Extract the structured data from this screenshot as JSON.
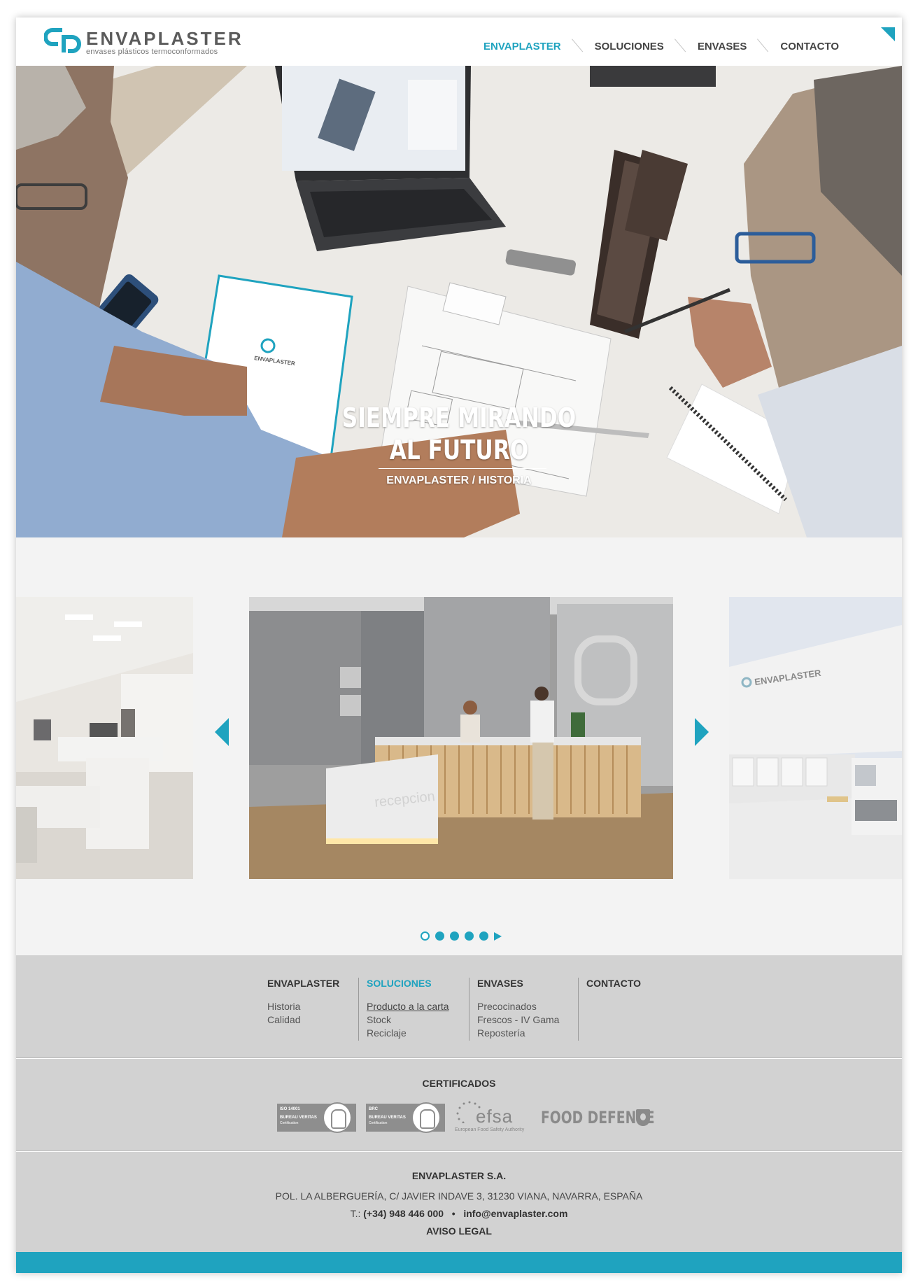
{
  "brand": {
    "name": "ENVAPLASTER",
    "tagline": "envases plásticos termoconformados",
    "accent_color": "#1fa3bf"
  },
  "nav": {
    "items": [
      {
        "label": "ENVAPLASTER",
        "active": true
      },
      {
        "label": "SOLUCIONES",
        "active": false
      },
      {
        "label": "ENVASES",
        "active": false
      },
      {
        "label": "CONTACTO",
        "active": false
      }
    ]
  },
  "hero": {
    "title_line1": "SIEMPRE MIRANDO",
    "title_line2": "AL FUTURO",
    "link": "ENVAPLASTER / HISTORIA",
    "folder_brand": "ENVAPLASTER"
  },
  "carousel": {
    "slides": [
      "office",
      "reception",
      "warehouse"
    ],
    "reception_sign": "recepcion",
    "building_sign": "ENVAPLASTER",
    "pager": {
      "count": 5,
      "current": 1
    }
  },
  "footer": {
    "columns": [
      {
        "title": "ENVAPLASTER",
        "active": false,
        "links": [
          "Historia",
          "Calidad"
        ]
      },
      {
        "title": "SOLUCIONES",
        "active": true,
        "links": [
          "Producto a la carta",
          "Stock",
          "Reciclaje"
        ]
      },
      {
        "title": "ENVASES",
        "active": false,
        "links": [
          "Precocinados",
          "Frescos - IV Gama",
          "Repostería"
        ]
      },
      {
        "title": "CONTACTO",
        "active": false,
        "links": []
      }
    ],
    "certificates": {
      "title": "CERTIFICADOS",
      "bv1": {
        "line1": "ISO 14001",
        "line2": "BUREAU VERITAS",
        "line3": "Certification"
      },
      "bv2": {
        "line1": "BRC",
        "line2": "BUREAU VERITAS",
        "line3": "Certification"
      },
      "efsa": {
        "word": "efsa",
        "sub": "European Food Safety Authority"
      },
      "food_defense": "FOOD DEFENSE"
    },
    "company": {
      "name": "ENVAPLASTER S.A.",
      "address": "POL. LA ALBERGUERÍA, C/ JAVIER INDAVE 3, 31230 VIANA, NAVARRA, ESPAÑA",
      "phone_label": "T.:",
      "phone": "(+34) 948 446 000",
      "separator": "•",
      "email": "info@envaplaster.com",
      "legal": "AVISO LEGAL"
    }
  }
}
